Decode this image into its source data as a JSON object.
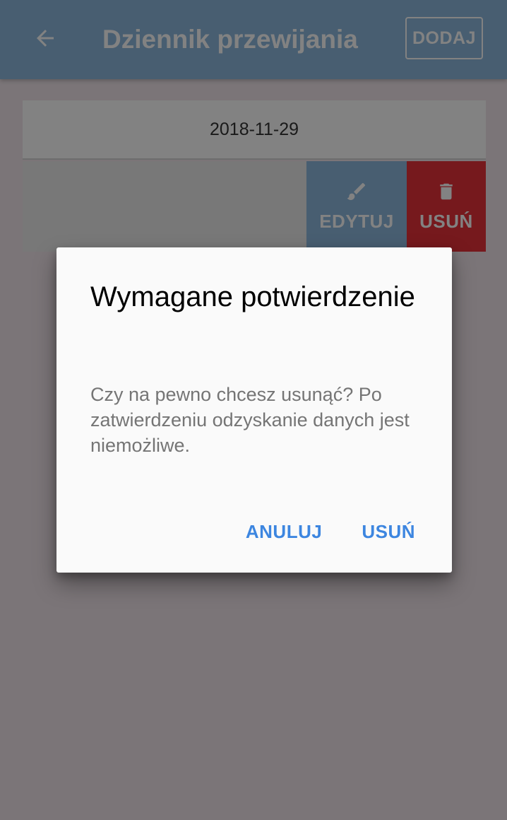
{
  "colors": {
    "appbar": "#8db9dd",
    "delete": "#e8313a",
    "accent": "#3d86e0",
    "background": "#f1e6ec"
  },
  "appbar": {
    "back_icon": "arrow-left-icon",
    "title": "Dziennik przewijania",
    "add_label": "DODAJ"
  },
  "list": {
    "date": "2018-11-29",
    "entry": {
      "edit_label": "EDYTUJ",
      "edit_icon": "brush-icon",
      "delete_label": "USUŃ",
      "delete_icon": "trash-icon"
    }
  },
  "dialog": {
    "title": "Wymagane potwierdzenie",
    "message": "Czy na pewno chcesz usunąć? Po zatwierdzeniu odzyskanie danych jest niemożliwe.",
    "cancel_label": "ANULUJ",
    "confirm_label": "USUŃ"
  }
}
